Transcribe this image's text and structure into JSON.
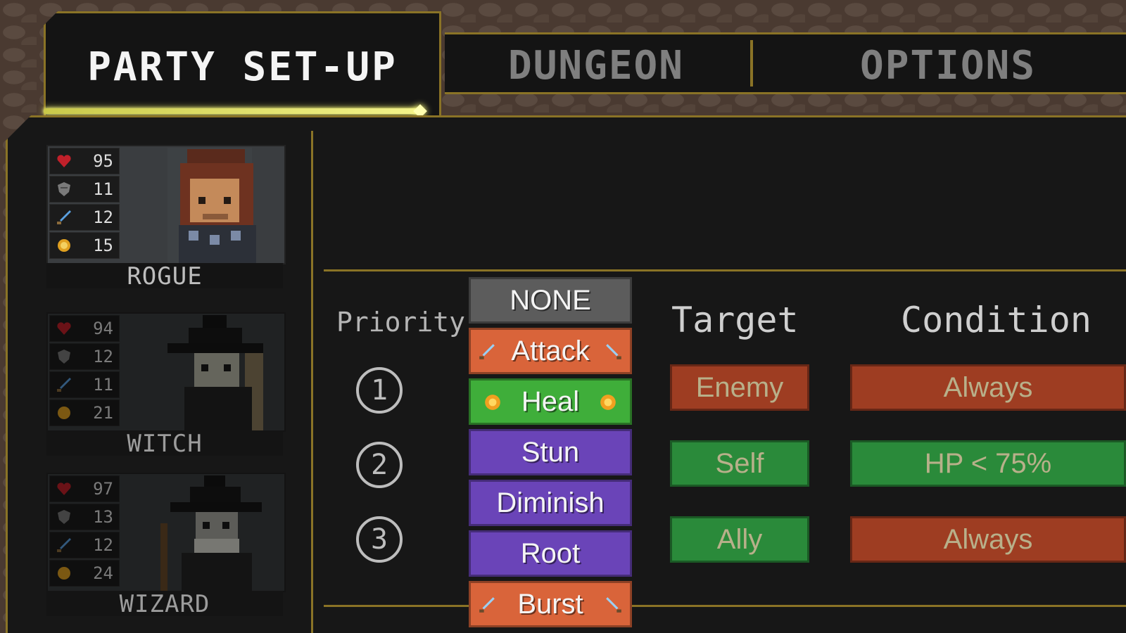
{
  "tabs": {
    "active": "PARTY SET-UP",
    "dungeon": "DUNGEON",
    "options": "OPTIONS"
  },
  "party": [
    {
      "name": "ROGUE",
      "hp": "95",
      "defense": "11",
      "attack": "12",
      "magic": "15",
      "selected": true
    },
    {
      "name": "WITCH",
      "hp": "94",
      "defense": "12",
      "attack": "11",
      "magic": "21",
      "selected": false
    },
    {
      "name": "WIZARD",
      "hp": "97",
      "defense": "13",
      "attack": "12",
      "magic": "24",
      "selected": false
    }
  ],
  "priority": {
    "label": "Priority",
    "numbers": [
      "1",
      "2",
      "3"
    ]
  },
  "skills": [
    {
      "label": "NONE",
      "color": "#5c5c5c",
      "icon": "none"
    },
    {
      "label": "Attack",
      "color": "#d9643a",
      "icon": "sword-icon"
    },
    {
      "label": "Heal",
      "color": "#3fae3a",
      "icon": "sun-icon"
    },
    {
      "label": "Stun",
      "color": "#6a44b8",
      "icon": "none"
    },
    {
      "label": "Diminish",
      "color": "#6a44b8",
      "icon": "none"
    },
    {
      "label": "Root",
      "color": "#6a44b8",
      "icon": "none"
    },
    {
      "label": "Burst",
      "color": "#d9643a",
      "icon": "sword-icon"
    }
  ],
  "columns": {
    "target": "Target",
    "condition": "Condition"
  },
  "rules": [
    {
      "target": "Enemy",
      "target_color": "#9e3d22",
      "condition": "Always",
      "condition_color": "#9e3d22"
    },
    {
      "target": "Self",
      "target_color": "#2a8a3a",
      "condition": "HP < 75%",
      "condition_color": "#2a8a3a"
    },
    {
      "target": "Ally",
      "target_color": "#2a8a3a",
      "condition": "Always",
      "condition_color": "#9e3d22"
    }
  ]
}
